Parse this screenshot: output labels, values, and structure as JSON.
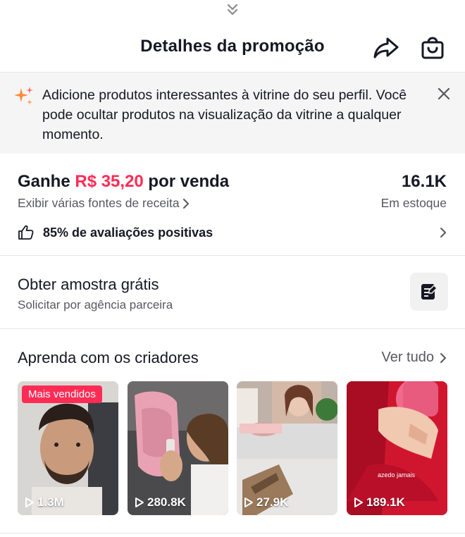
{
  "header": {
    "title": "Detalhes da promoção",
    "icons": [
      "chevron-double-down-icon",
      "share-icon",
      "shopping-bag-icon"
    ]
  },
  "banner": {
    "icon": "sparkle-icon",
    "message": "Adicione produtos interessantes à vitrine do seu perfil. Você pode ocultar produtos na visualização da vitrine a qualquer momento.",
    "close_icon": "close-icon"
  },
  "earnings": {
    "prefix": "Ganhe ",
    "amount": "R$ 35,20",
    "suffix": " por venda",
    "sources_link": "Exibir várias fontes de receita",
    "stock_value": "16.1K",
    "stock_label": "Em estoque",
    "rating_text": "85% de avaliações positivas"
  },
  "sample": {
    "title": "Obter amostra grátis",
    "subtitle": "Solicitar por agência parceira"
  },
  "learn": {
    "title": "Aprenda com os criadores",
    "see_all": "Ver tudo",
    "videos": [
      {
        "views": "1.3M",
        "badge": "Mais vendidos"
      },
      {
        "views": "280.8K"
      },
      {
        "views": "27.9K"
      },
      {
        "views": "189.1K",
        "tag": "azedo jamais"
      }
    ]
  },
  "colors": {
    "accent": "#fe2c55",
    "text": "#161823",
    "secondary": "#57585f",
    "banner_bg": "#f5f5f6"
  }
}
